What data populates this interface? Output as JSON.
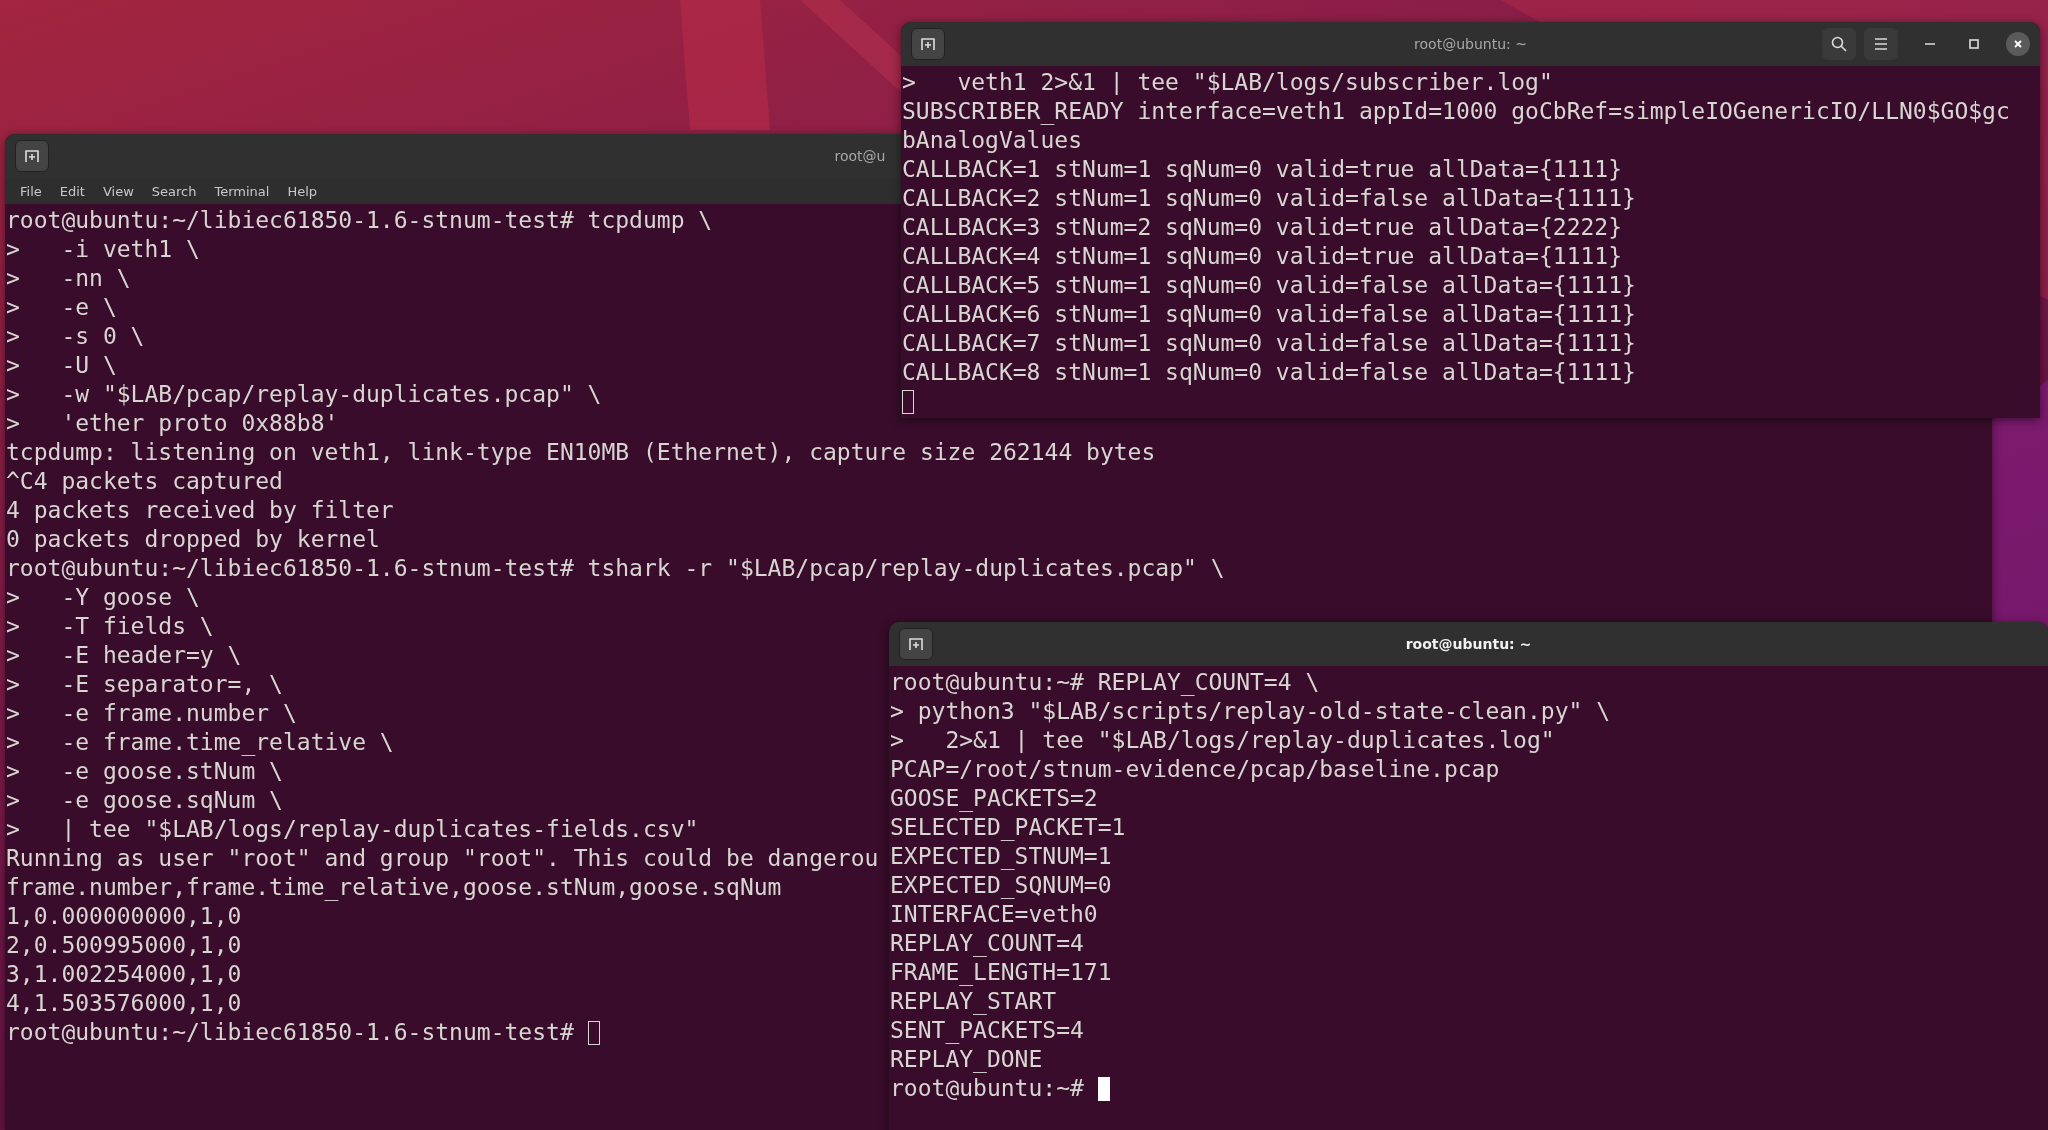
{
  "windows": [
    {
      "title": "root@u",
      "focused": false,
      "buttons": [
        {
          "kind": "new-tab"
        }
      ],
      "menu": [
        "File",
        "Edit",
        "View",
        "Search",
        "Terminal",
        "Help"
      ],
      "lines": [
        "root@ubuntu:~/libiec61850-1.6-stnum-test# tcpdump \\",
        ">   -i veth1 \\",
        ">   -nn \\",
        ">   -e \\",
        ">   -s 0 \\",
        ">   -U \\",
        ">   -w \"$LAB/pcap/replay-duplicates.pcap\" \\",
        ">   'ether proto 0x88b8'",
        "tcpdump: listening on veth1, link-type EN10MB (Ethernet), capture size 262144 bytes",
        "^C4 packets captured",
        "4 packets received by filter",
        "0 packets dropped by kernel",
        "root@ubuntu:~/libiec61850-1.6-stnum-test# tshark -r \"$LAB/pcap/replay-duplicates.pcap\" \\",
        ">   -Y goose \\",
        ">   -T fields \\",
        ">   -E header=y \\",
        ">   -E separator=, \\",
        ">   -e frame.number \\",
        ">   -e frame.time_relative \\",
        ">   -e goose.stNum \\",
        ">   -e goose.sqNum \\",
        ">   | tee \"$LAB/logs/replay-duplicates-fields.csv\"",
        "Running as user \"root\" and group \"root\". This could be dangerou",
        "frame.number,frame.time_relative,goose.stNum,goose.sqNum",
        "1,0.000000000,1,0",
        "2,0.500995000,1,0",
        "3,1.002254000,1,0",
        "4,1.503576000,1,0"
      ],
      "input": "root@ubuntu:~/libiec61850-1.6-stnum-test# "
    },
    {
      "title": "root@ubuntu: ~",
      "focused": false,
      "buttons": [
        {
          "kind": "new-tab"
        },
        {
          "kind": "search"
        },
        {
          "kind": "menu"
        },
        {
          "kind": "minimize"
        },
        {
          "kind": "maximize"
        },
        {
          "kind": "close"
        }
      ],
      "lines": [
        ">   veth1 2>&1 | tee \"$LAB/logs/subscriber.log\"",
        "SUBSCRIBER_READY interface=veth1 appId=1000 goCbRef=simpleIOGenericIO/LLN0$GO$gc",
        "bAnalogValues",
        "CALLBACK=1 stNum=1 sqNum=0 valid=true allData={1111}",
        "CALLBACK=2 stNum=1 sqNum=0 valid=false allData={1111}",
        "CALLBACK=3 stNum=2 sqNum=0 valid=true allData={2222}",
        "CALLBACK=4 stNum=1 sqNum=0 valid=true allData={1111}",
        "CALLBACK=5 stNum=1 sqNum=0 valid=false allData={1111}",
        "CALLBACK=6 stNum=1 sqNum=0 valid=false allData={1111}",
        "CALLBACK=7 stNum=1 sqNum=0 valid=false allData={1111}",
        "CALLBACK=8 stNum=1 sqNum=0 valid=false allData={1111}"
      ]
    },
    {
      "title": "root@ubuntu: ~",
      "focused": true,
      "buttons": [
        {
          "kind": "new-tab"
        }
      ],
      "lines": [
        "root@ubuntu:~# REPLAY_COUNT=4 \\",
        "> python3 \"$LAB/scripts/replay-old-state-clean.py\" \\",
        ">   2>&1 | tee \"$LAB/logs/replay-duplicates.log\"",
        "PCAP=/root/stnum-evidence/pcap/baseline.pcap",
        "GOOSE_PACKETS=2",
        "SELECTED_PACKET=1",
        "EXPECTED_STNUM=1",
        "EXPECTED_SQNUM=0",
        "INTERFACE=veth0",
        "REPLAY_COUNT=4",
        "FRAME_LENGTH=171",
        "REPLAY_START",
        "SENT_PACKETS=4",
        "REPLAY_DONE"
      ],
      "input": "root@ubuntu:~# "
    }
  ]
}
